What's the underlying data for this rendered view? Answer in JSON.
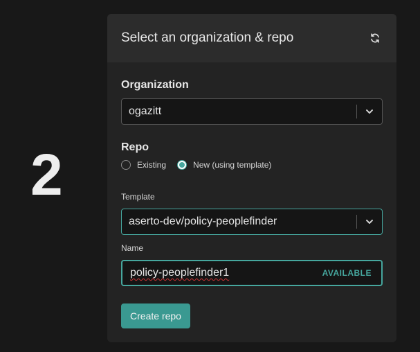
{
  "step_number": "2",
  "card": {
    "title": "Select an organization & repo",
    "refresh_icon": "refresh-icon"
  },
  "organization": {
    "label": "Organization",
    "selected": "ogazitt"
  },
  "repo": {
    "label": "Repo",
    "options": [
      {
        "label": "Existing",
        "checked": false
      },
      {
        "label": "New (using template)",
        "checked": true
      }
    ]
  },
  "template": {
    "label": "Template",
    "selected": "aserto-dev/policy-peoplefinder"
  },
  "name": {
    "label": "Name",
    "value": "policy-peoplefinder1",
    "status": "AVAILABLE"
  },
  "create_button": {
    "label": "Create repo"
  },
  "colors": {
    "accent": "#46a79e",
    "button": "#3a9991",
    "background": "#181818",
    "card": "#232323",
    "card_header": "#2c2c2c"
  }
}
